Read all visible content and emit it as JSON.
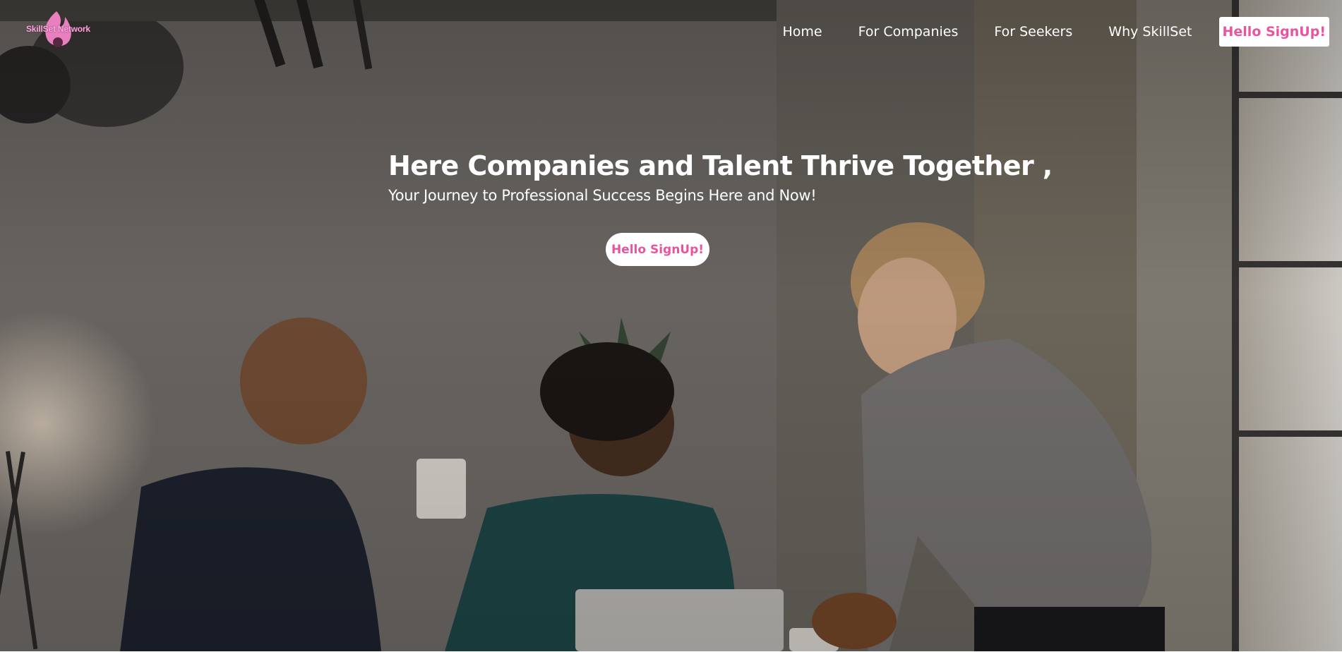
{
  "brand": {
    "logo_text": "SkillSet Network",
    "accent": "#e8559f"
  },
  "nav": {
    "links": [
      {
        "label": "Home"
      },
      {
        "label": "For Companies"
      },
      {
        "label": "For Seekers"
      },
      {
        "label": "Why SkillSet"
      }
    ],
    "cta_label": "Hello SignUp!"
  },
  "hero": {
    "title": "Here Companies and Talent Thrive Together ,",
    "subtitle": "Your Journey to Professional Success Begins Here and Now!",
    "cta_label": "Hello SignUp!",
    "background": "office-team-photo"
  }
}
